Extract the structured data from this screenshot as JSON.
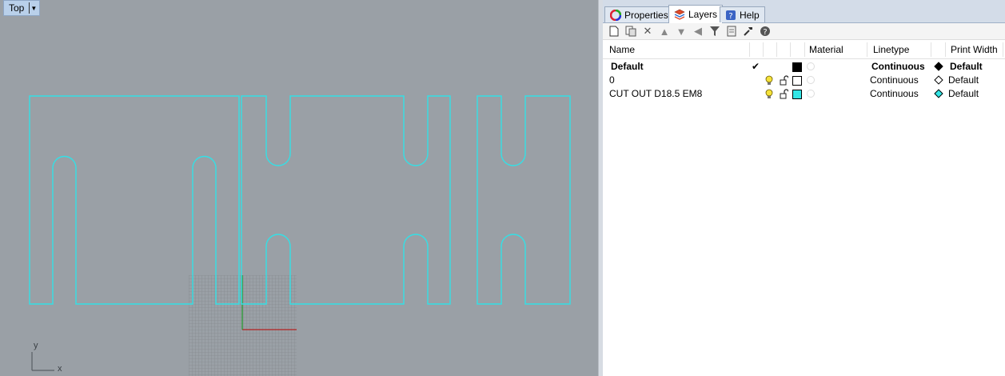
{
  "viewport": {
    "title": "Top",
    "dropdown_icon": "triangle-down-icon",
    "outline_color": "#33e0e6",
    "background_color": "#9aa0a6",
    "axis_x_label": "x",
    "axis_y_label": "y"
  },
  "panel": {
    "tabs": [
      {
        "label": "Properties",
        "icon": "color-wheel-icon"
      },
      {
        "label": "Layers",
        "icon": "layers-icon",
        "active": true
      },
      {
        "label": "Help",
        "icon": "help-icon"
      }
    ],
    "toolbar_icons": [
      "new-layer-icon",
      "new-sublayer-icon",
      "delete-icon",
      "move-up-icon",
      "move-down-icon",
      "move-left-icon",
      "filter-icon",
      "layer-page-icon",
      "tools-icon",
      "help-circle-icon"
    ],
    "columns": {
      "name": "Name",
      "material": "Material",
      "linetype": "Linetype",
      "print_width": "Print Width"
    },
    "layers": [
      {
        "name": "Default",
        "current": true,
        "current_mark": "✔",
        "color": "#000000",
        "linetype": "Continuous",
        "print_width": "Default",
        "print_color": "#000000"
      },
      {
        "name": "0",
        "current": false,
        "color": "#ffffff",
        "linetype": "Continuous",
        "print_width": "Default",
        "print_color": "#ffffff"
      },
      {
        "name": "CUT OUT D18.5 EM8",
        "current": false,
        "color": "#33e6e6",
        "linetype": "Continuous",
        "print_width": "Default",
        "print_color": "#33e6e6"
      }
    ]
  }
}
